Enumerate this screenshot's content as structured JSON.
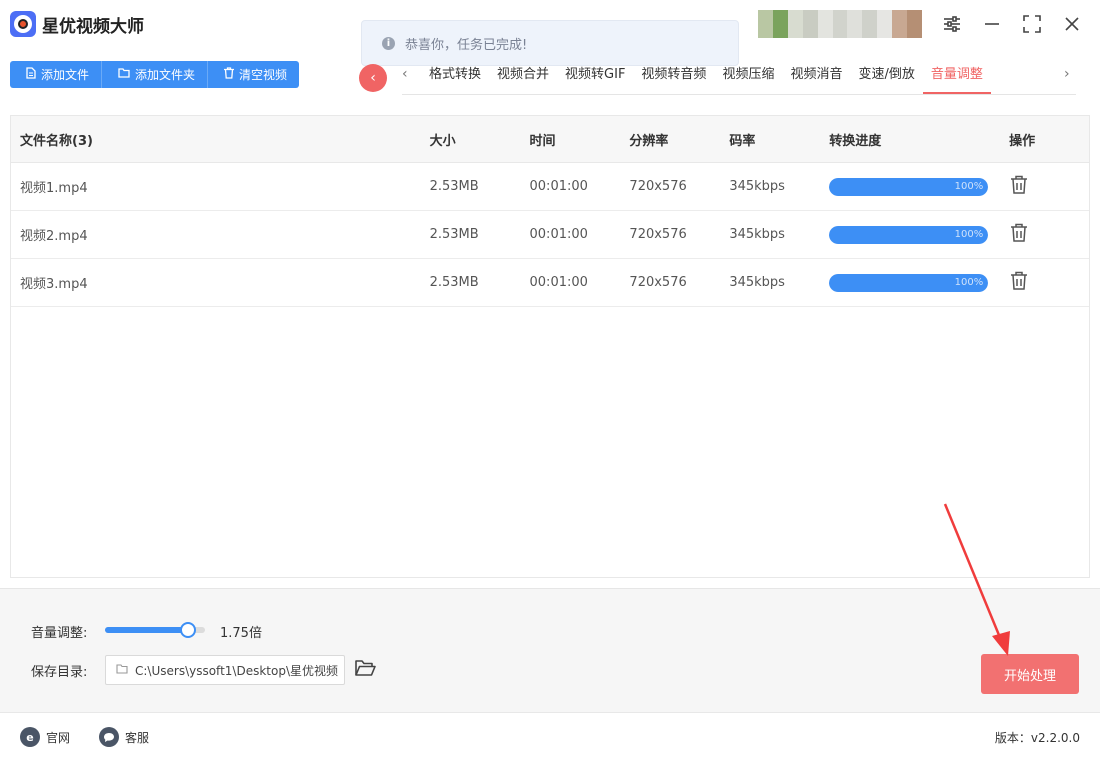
{
  "app": {
    "title": "星优视频大师"
  },
  "toast": {
    "message": "恭喜你，任务已完成!"
  },
  "toolbar": {
    "add_file": "添加文件",
    "add_folder": "添加文件夹",
    "clear_videos": "清空视频"
  },
  "tabs": [
    {
      "label": "格式转换",
      "active": false
    },
    {
      "label": "视频合并",
      "active": false
    },
    {
      "label": "视频转GIF",
      "active": false
    },
    {
      "label": "视频转音频",
      "active": false
    },
    {
      "label": "视频压缩",
      "active": false
    },
    {
      "label": "视频消音",
      "active": false
    },
    {
      "label": "变速/倒放",
      "active": false
    },
    {
      "label": "音量调整",
      "active": true
    }
  ],
  "table": {
    "headers": {
      "name": "文件名称(3)",
      "size": "大小",
      "time": "时间",
      "resolution": "分辨率",
      "bitrate": "码率",
      "progress": "转换进度",
      "action": "操作"
    },
    "rows": [
      {
        "name": "视频1.mp4",
        "size": "2.53MB",
        "time": "00:01:00",
        "resolution": "720x576",
        "bitrate": "345kbps",
        "progress": 100,
        "progress_label": "100%"
      },
      {
        "name": "视频2.mp4",
        "size": "2.53MB",
        "time": "00:01:00",
        "resolution": "720x576",
        "bitrate": "345kbps",
        "progress": 100,
        "progress_label": "100%"
      },
      {
        "name": "视频3.mp4",
        "size": "2.53MB",
        "time": "00:01:00",
        "resolution": "720x576",
        "bitrate": "345kbps",
        "progress": 100,
        "progress_label": "100%"
      }
    ]
  },
  "settings": {
    "volume_label": "音量调整:",
    "volume_value": "1.75倍",
    "volume_slider_level": 0.83,
    "save_dir_label": "保存目录:",
    "save_dir_value": "C:\\Users\\yssoft1\\Desktop\\星优视频"
  },
  "start_button": "开始处理",
  "footer": {
    "website": "官网",
    "support": "客服",
    "version": "版本：v2.2.0.0"
  },
  "colors": {
    "primary": "#3d8ff5",
    "accent_red": "#f06464",
    "start_button": "#f27171"
  }
}
